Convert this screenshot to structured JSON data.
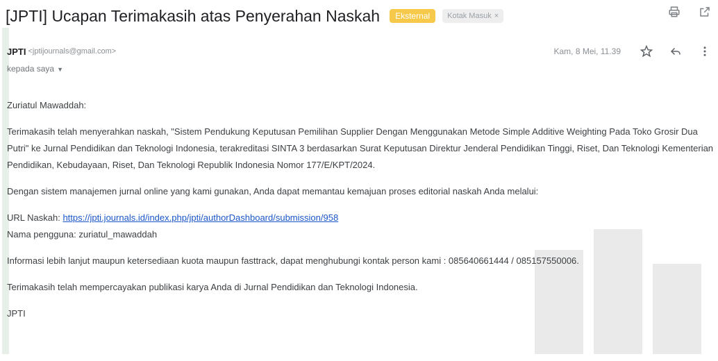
{
  "email": {
    "subject": "[JPTI] Ucapan Terimakasih atas Penyerahan Naskah",
    "labels": {
      "external": "Eksternal",
      "inbox": "Kotak Masuk",
      "inbox_remove": "×"
    },
    "sender": {
      "name": "JPTI",
      "address": "<jptijournals@gmail.com>"
    },
    "date": "Kam, 8 Mei, 11.39",
    "recipient": "kepada saya",
    "greeting": "Zuriatul Mawaddah:",
    "paragraph1": "Terimakasih telah menyerahkan naskah, \"Sistem Pendukung Keputusan Pemilihan Supplier Dengan Menggunakan Metode Simple Additive Weighting Pada Toko Grosir Dua Putri\" ke Jurnal Pendidikan dan Teknologi Indonesia, terakreditasi SINTA 3 berdasarkan Surat Keputusan Direktur Jenderal Pendidikan Tinggi, Riset, Dan Teknologi Kementerian Pendidikan, Kebudayaan, Riset, Dan Teknologi Republik Indonesia Nomor 177/E/KPT/2024.",
    "paragraph2": "Dengan sistem manajemen jurnal online yang kami gunakan, Anda dapat memantau kemajuan proses editorial naskah Anda melalui:",
    "url_label": "URL Naskah: ",
    "url": "https://jpti.journals.id/index.php/jpti/authorDashboard/submission/958",
    "username_line": "Nama pengguna: zuriatul_mawaddah",
    "paragraph3": "Informasi lebih lanjut maupun ketersediaan kuota maupun fasttrack, dapat menghubungi kontak person kami : 085640661444 / 085157550006.",
    "paragraph4": "Terimakasih telah mempercayakan publikasi karya Anda di Jurnal Pendidikan dan Teknologi Indonesia.",
    "signature": "JPTI"
  },
  "icons": {
    "print": "print-icon",
    "open_new": "open-in-new-window-icon",
    "star": "star-icon",
    "reply": "reply-icon",
    "more": "more-vert-icon"
  },
  "colors": {
    "badge_external": "#f6c94a",
    "link": "#1a56c7"
  }
}
